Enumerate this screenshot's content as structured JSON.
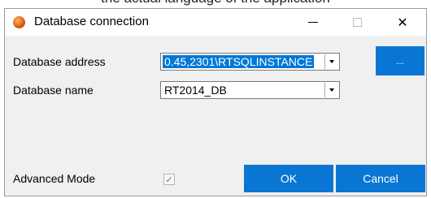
{
  "background_text": "the actual language of the application",
  "window": {
    "title": "Database connection",
    "minimize_glyph": "minimize-icon",
    "maximize_glyph": "maximize-icon",
    "close_symbol": "✕"
  },
  "form": {
    "address_label": "Database address",
    "address_value": "0.45,2301\\RTSQLINSTANCE",
    "browse_label": "...",
    "name_label": "Database name",
    "name_value": "RT2014_DB",
    "advanced_label": "Advanced Mode",
    "advanced_checked": true,
    "check_symbol": "✓"
  },
  "buttons": {
    "ok_label": "OK",
    "cancel_label": "Cancel"
  },
  "colors": {
    "accent": "#0a76d4",
    "selection": "#0078d7",
    "window_bg": "#f0f0f0"
  }
}
